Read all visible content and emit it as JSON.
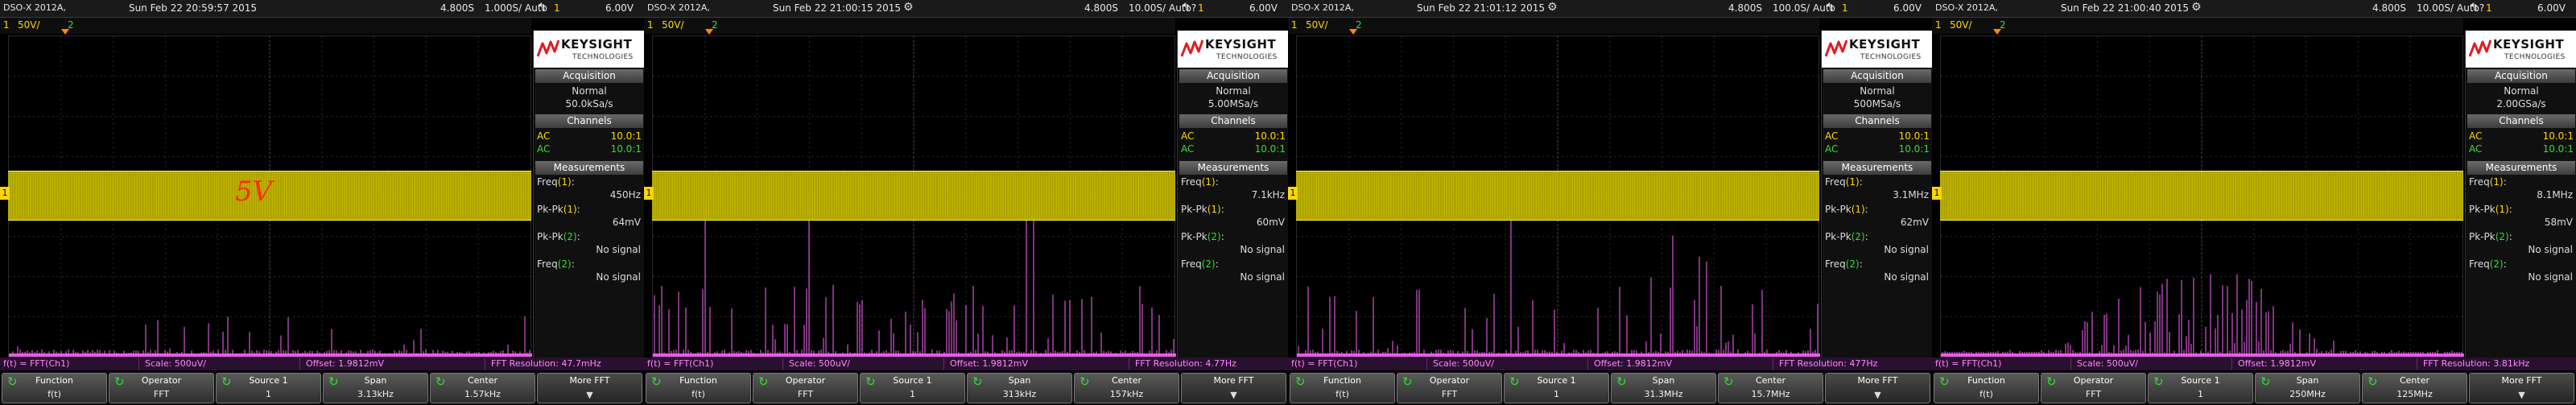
{
  "colors": {
    "ch1": "#ffd700",
    "ch2": "#33dd33",
    "math": "#ff66ff",
    "annotation": "#ff2a00"
  },
  "scopes": [
    {
      "model": "DSO-X 2012A,",
      "datetime": "Sun Feb 22 20:59:57 2015",
      "ch1_label": "1",
      "ch1_scale": "50V/",
      "ch2_label": "2",
      "timebase_scale": "4.800S",
      "sample_rate": "1.000S/",
      "timebase_mode": "Auto",
      "trig_channel": "1",
      "trig_level": "6.00V",
      "run_icon": "",
      "acquisition_header": "Acquisition",
      "acq_mode": "Normal",
      "acq_rate": "50.0kSa/s",
      "channels_header": "Channels",
      "ch_rows": [
        {
          "coupling": "AC",
          "probe": "10.0:1"
        },
        {
          "coupling": "AC",
          "probe": "10.0:1"
        }
      ],
      "measurements_header": "Measurements",
      "measurements": [
        {
          "name": "Freq",
          "chan": "(1)",
          "value": "450Hz"
        },
        {
          "name": "Pk-Pk",
          "chan": "(1)",
          "value": "64mV"
        },
        {
          "name": "Pk-Pk",
          "chan": "(2)",
          "value": "No signal"
        },
        {
          "name": "Freq",
          "chan": "(2)",
          "value": "No signal"
        }
      ],
      "annotation": "5V",
      "math_function": "f(t) = FFT(Ch1)",
      "math_scale": "Scale: 500uV/",
      "math_offset": "Offset: 1.9812mV",
      "fft_resolution": "FFT Resolution: 47.7mHz",
      "softkeys": {
        "function_label": "Function",
        "function_value": "f(t)",
        "operator_label": "Operator",
        "operator_value": "FFT",
        "source_label": "Source 1",
        "source_value": "1",
        "span_label": "Span",
        "span_value": "3.13kHz",
        "center_label": "Center",
        "center_value": "1.57kHz",
        "more_label": "More FFT"
      },
      "spectrum_seed": 7,
      "spectrum_style": "flat"
    },
    {
      "model": "DSO-X 2012A,",
      "datetime": "Sun Feb 22 21:00:15 2015",
      "ch1_label": "1",
      "ch1_scale": "50V/",
      "ch2_label": "2",
      "timebase_scale": "4.800S",
      "sample_rate": "10.00S/",
      "timebase_mode": "Auto?",
      "trig_channel": "1",
      "trig_level": "6.00V",
      "run_icon": "⚙",
      "acquisition_header": "Acquisition",
      "acq_mode": "Normal",
      "acq_rate": "5.00MSa/s",
      "channels_header": "Channels",
      "ch_rows": [
        {
          "coupling": "AC",
          "probe": "10.0:1"
        },
        {
          "coupling": "AC",
          "probe": "10.0:1"
        }
      ],
      "measurements_header": "Measurements",
      "measurements": [
        {
          "name": "Freq",
          "chan": "(1)",
          "value": "7.1kHz"
        },
        {
          "name": "Pk-Pk",
          "chan": "(1)",
          "value": "60mV"
        },
        {
          "name": "Pk-Pk",
          "chan": "(2)",
          "value": "No signal"
        },
        {
          "name": "Freq",
          "chan": "(2)",
          "value": "No signal"
        }
      ],
      "annotation": "",
      "math_function": "f(t) = FFT(Ch1)",
      "math_scale": "Scale: 500uV/",
      "math_offset": "Offset: 1.9812mV",
      "fft_resolution": "FFT Resolution: 4.77Hz",
      "softkeys": {
        "function_label": "Function",
        "function_value": "f(t)",
        "operator_label": "Operator",
        "operator_value": "FFT",
        "source_label": "Source 1",
        "source_value": "1",
        "span_label": "Span",
        "span_value": "313kHz",
        "center_label": "Center",
        "center_value": "157kHz",
        "more_label": "More FFT"
      },
      "spectrum_seed": 19,
      "spectrum_style": "spiky"
    },
    {
      "model": "DSO-X 2012A,",
      "datetime": "Sun Feb 22 21:01:12 2015",
      "ch1_label": "1",
      "ch1_scale": "50V/",
      "ch2_label": "2",
      "timebase_scale": "4.800S",
      "sample_rate": "100.0S/",
      "timebase_mode": "Auto",
      "trig_channel": "1",
      "trig_level": "6.00V",
      "run_icon": "⚙",
      "acquisition_header": "Acquisition",
      "acq_mode": "Normal",
      "acq_rate": "500MSa/s",
      "channels_header": "Channels",
      "ch_rows": [
        {
          "coupling": "AC",
          "probe": "10.0:1"
        },
        {
          "coupling": "AC",
          "probe": "10.0:1"
        }
      ],
      "measurements_header": "Measurements",
      "measurements": [
        {
          "name": "Freq",
          "chan": "(1)",
          "value": "3.1MHz"
        },
        {
          "name": "Pk-Pk",
          "chan": "(1)",
          "value": "62mV"
        },
        {
          "name": "Pk-Pk",
          "chan": "(2)",
          "value": "No signal"
        },
        {
          "name": "Freq",
          "chan": "(2)",
          "value": "No signal"
        }
      ],
      "annotation": "",
      "math_function": "f(t) = FFT(Ch1)",
      "math_scale": "Scale: 500uV/",
      "math_offset": "Offset: 1.9812mV",
      "fft_resolution": "FFT Resolution: 477Hz",
      "softkeys": {
        "function_label": "Function",
        "function_value": "f(t)",
        "operator_label": "Operator",
        "operator_value": "FFT",
        "source_label": "Source 1",
        "source_value": "1",
        "span_label": "Span",
        "span_value": "31.3MHz",
        "center_label": "Center",
        "center_value": "15.7MHz",
        "more_label": "More FFT"
      },
      "spectrum_seed": 31,
      "spectrum_style": "spiky"
    },
    {
      "model": "DSO-X 2012A,",
      "datetime": "Sun Feb 22 21:00:40 2015",
      "ch1_label": "1",
      "ch1_scale": "50V/",
      "ch2_label": "2",
      "timebase_scale": "4.800S",
      "sample_rate": "10.00S/",
      "timebase_mode": "Auto?",
      "trig_channel": "1",
      "trig_level": "6.00V",
      "run_icon": "⚙",
      "acquisition_header": "Acquisition",
      "acq_mode": "Normal",
      "acq_rate": "2.00GSa/s",
      "channels_header": "Channels",
      "ch_rows": [
        {
          "coupling": "AC",
          "probe": "10.0:1"
        },
        {
          "coupling": "AC",
          "probe": "10.0:1"
        }
      ],
      "measurements_header": "Measurements",
      "measurements": [
        {
          "name": "Freq",
          "chan": "(1)",
          "value": "8.1MHz"
        },
        {
          "name": "Pk-Pk",
          "chan": "(1)",
          "value": "58mV"
        },
        {
          "name": "Pk-Pk",
          "chan": "(2)",
          "value": "No signal"
        },
        {
          "name": "Freq",
          "chan": "(2)",
          "value": "No signal"
        }
      ],
      "annotation": "",
      "math_function": "f(t) = FFT(Ch1)",
      "math_scale": "Scale: 500uV/",
      "math_offset": "Offset: 1.9812mV",
      "fft_resolution": "FFT Resolution: 3.81kHz",
      "softkeys": {
        "function_label": "Function",
        "function_value": "f(t)",
        "operator_label": "Operator",
        "operator_value": "FFT",
        "source_label": "Source 1",
        "source_value": "1",
        "span_label": "Span",
        "span_value": "250MHz",
        "center_label": "Center",
        "center_value": "125MHz",
        "more_label": "More FFT"
      },
      "spectrum_seed": 53,
      "spectrum_style": "hump"
    }
  ],
  "logo": {
    "name": "KEYSIGHT",
    "sub": "TECHNOLOGIES"
  }
}
